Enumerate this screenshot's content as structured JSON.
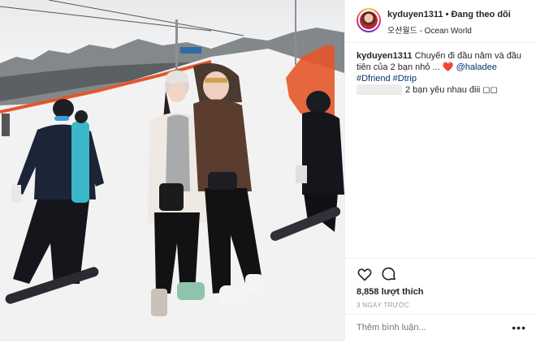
{
  "post": {
    "username": "kyduyen1311",
    "separator": "•",
    "follow_status": "Đang theo dõi",
    "location": "오션월드 - Ocean World",
    "caption": {
      "username": "kyduyen1311",
      "text": "Chuyến đi đầu năm và đầu tiên của 2 bạn nhỏ ... ",
      "emoji": "❤️",
      "mention": "@haladee",
      "hashtags": "#Dfriend #Dtrip"
    },
    "comment": {
      "text": "2 bạn yêu nhau điii ◻◻"
    },
    "likes": "8,858 lượt thích",
    "timestamp": "3 NGÀY TRƯỚC",
    "add_comment_placeholder": "Thêm bình luận...",
    "more_label": "•••"
  },
  "icons": {
    "like": "heart-outline-icon",
    "comment": "speech-bubble-icon",
    "more": "ellipsis-icon"
  }
}
